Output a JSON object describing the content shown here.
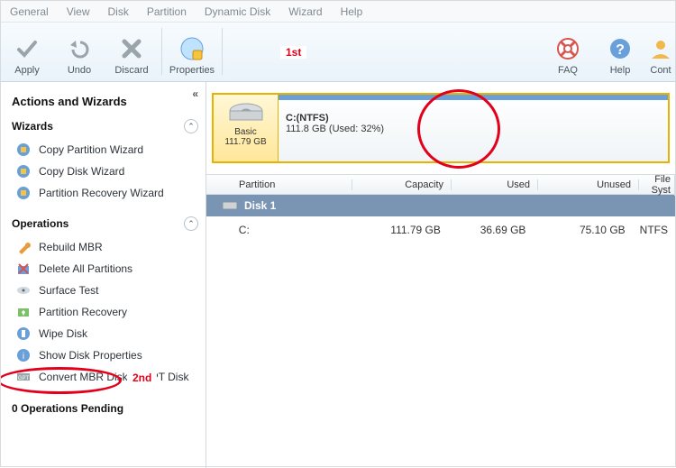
{
  "menu": [
    "General",
    "View",
    "Disk",
    "Partition",
    "Dynamic Disk",
    "Wizard",
    "Help"
  ],
  "toolbar": {
    "apply": "Apply",
    "undo": "Undo",
    "discard": "Discard",
    "properties": "Properties",
    "faq": "FAQ",
    "help": "Help",
    "contact": "Cont"
  },
  "annotations": {
    "first": "1st",
    "second": "2nd"
  },
  "sidebar": {
    "title": "Actions and Wizards",
    "wizards_label": "Wizards",
    "wizards": [
      "Copy Partition Wizard",
      "Copy Disk Wizard",
      "Partition Recovery Wizard"
    ],
    "operations_label": "Operations",
    "operations": [
      "Rebuild MBR",
      "Delete All Partitions",
      "Surface Test",
      "Partition Recovery",
      "Wipe Disk",
      "Show Disk Properties",
      "Convert MBR Disk to GPT Disk"
    ],
    "pending": "0 Operations Pending"
  },
  "diskcard": {
    "name": "Basic",
    "size": "111.79 GB"
  },
  "volume": {
    "label": "C:(NTFS)",
    "detail": "111.8 GB (Used: 32%)"
  },
  "table": {
    "headers": {
      "partition": "Partition",
      "capacity": "Capacity",
      "used": "Used",
      "unused": "Unused",
      "fs": "File Syst"
    },
    "group": "Disk 1",
    "row": {
      "partition": "C:",
      "capacity": "111.79 GB",
      "used": "36.69 GB",
      "unused": "75.10 GB",
      "fs": "NTFS"
    }
  }
}
